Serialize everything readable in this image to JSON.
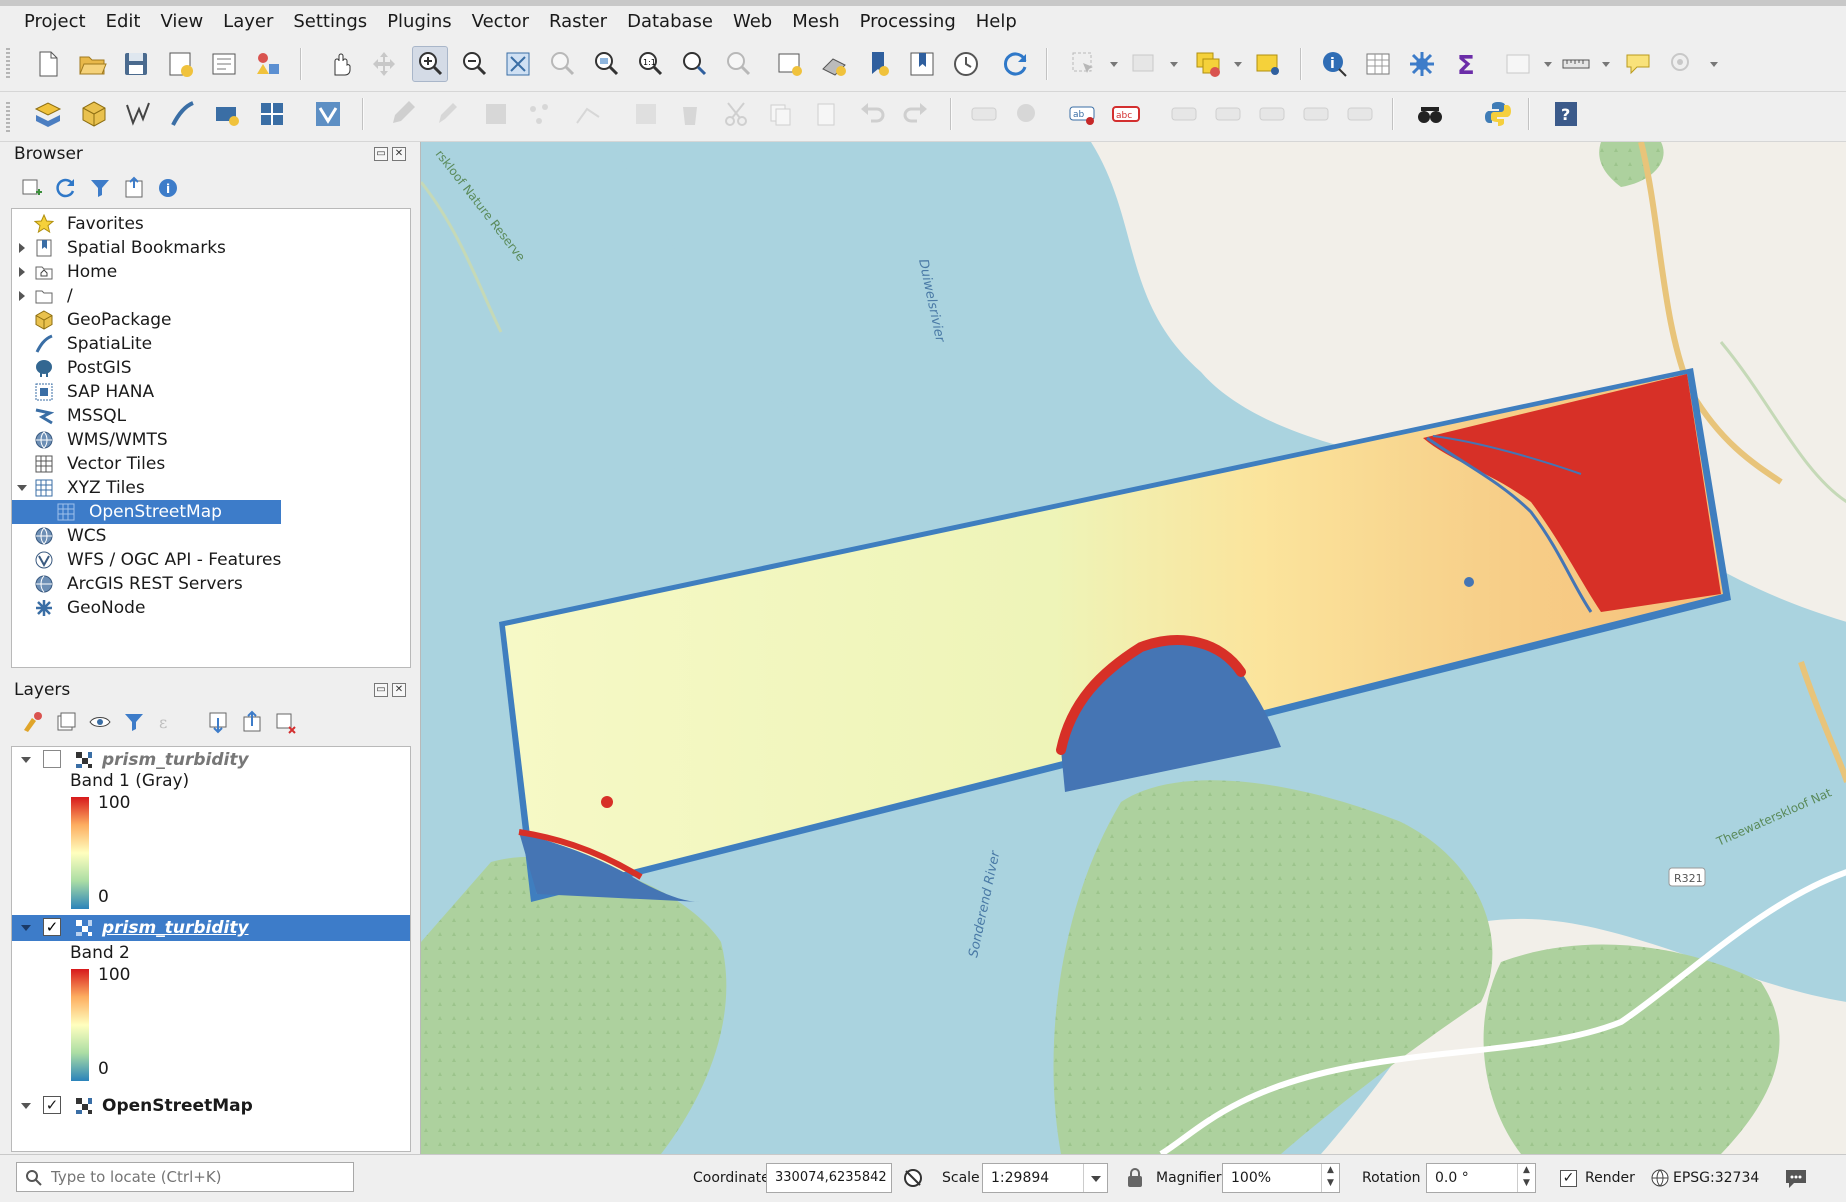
{
  "menu": [
    "Project",
    "Edit",
    "View",
    "Layer",
    "Settings",
    "Plugins",
    "Vector",
    "Raster",
    "Database",
    "Web",
    "Mesh",
    "Processing",
    "Help"
  ],
  "browser": {
    "title": "Browser",
    "items": [
      {
        "label": "Favorites",
        "icon": "star-icon"
      },
      {
        "label": "Spatial Bookmarks",
        "icon": "bookmark-icon"
      },
      {
        "label": "Home",
        "icon": "home-folder-icon"
      },
      {
        "label": "/",
        "icon": "folder-icon"
      },
      {
        "label": "GeoPackage",
        "icon": "geopackage-icon"
      },
      {
        "label": "SpatiaLite",
        "icon": "spatialite-icon"
      },
      {
        "label": "PostGIS",
        "icon": "postgis-icon"
      },
      {
        "label": "SAP HANA",
        "icon": "sap-hana-icon"
      },
      {
        "label": "MSSQL",
        "icon": "mssql-icon"
      },
      {
        "label": "WMS/WMTS",
        "icon": "wms-icon"
      },
      {
        "label": "Vector Tiles",
        "icon": "vector-tiles-icon"
      },
      {
        "label": "XYZ Tiles",
        "icon": "xyz-tiles-icon"
      },
      {
        "label": "OpenStreetMap",
        "icon": "xyz-tiles-icon"
      },
      {
        "label": "WCS",
        "icon": "wcs-icon"
      },
      {
        "label": "WFS / OGC API - Features",
        "icon": "wfs-icon"
      },
      {
        "label": "ArcGIS REST Servers",
        "icon": "arcgis-icon"
      },
      {
        "label": "GeoNode",
        "icon": "geonode-icon"
      }
    ]
  },
  "layers": {
    "title": "Layers",
    "items": [
      {
        "name": "prism_turbidity",
        "band": "Band 1 (Gray)",
        "max": "100",
        "min": "0",
        "checked": false
      },
      {
        "name": "prism_turbidity",
        "band": "Band 2",
        "max": "100",
        "min": "0",
        "checked": true
      },
      {
        "name": "OpenStreetMap",
        "checked": true
      }
    ]
  },
  "map": {
    "labels": [
      "rskloof Nature Reserve",
      "Duiwelsrivier",
      "Sonderend River",
      "Theewaterskloof Nat",
      "R321"
    ]
  },
  "status": {
    "locate_placeholder": "Type to locate (Ctrl+K)",
    "coordinate_label": "Coordinate",
    "coordinate": "330074,6235842",
    "scale_label": "Scale",
    "scale": "1:29894",
    "magnifier_label": "Magnifier",
    "magnifier": "100%",
    "rotation_label": "Rotation",
    "rotation": "0.0 °",
    "render_label": "Render",
    "crs": "EPSG:32734"
  },
  "colors": {
    "selection": "#3d7cc9",
    "ramp_high": "#d7191c",
    "ramp_mid": "#ffffbf",
    "ramp_low": "#2b83ba",
    "water": "#aad3df",
    "forest": "#add19e"
  }
}
